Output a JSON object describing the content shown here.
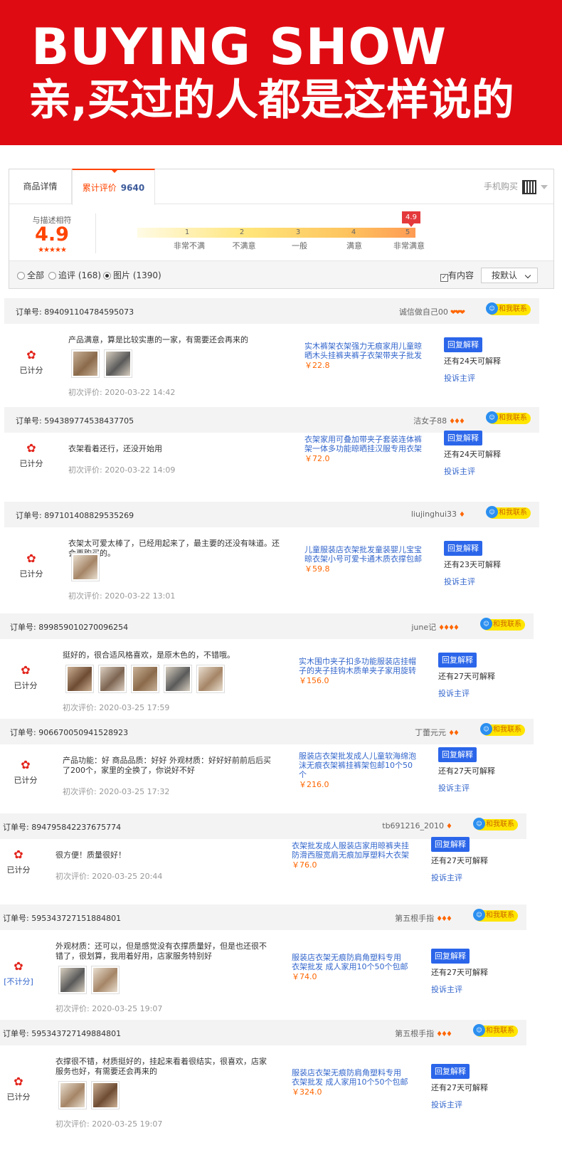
{
  "banner": {
    "title_en": "BUYING SHOW",
    "title_cn": "亲,买过的人都是这样说的"
  },
  "tabs": {
    "detail": "商品详情",
    "reviews": "累计评价",
    "reviews_count": "9640",
    "mobile_buy": "手机购买"
  },
  "rating": {
    "label": "与描述相符",
    "score": "4.9",
    "stars": "★★★★★",
    "flag": "4.9",
    "level": 4.9,
    "ticks": [
      "1",
      "2",
      "3",
      "4",
      "5"
    ],
    "tick_labels": [
      "非常不满",
      "不满意",
      "一般",
      "满意",
      "非常满意"
    ]
  },
  "filters": {
    "all": "全部",
    "followup": "追评 (168)",
    "pictures": "图片 (1390)",
    "has_content": "有内容",
    "sort": "按默认"
  },
  "common": {
    "order_label": "订单号: ",
    "contact": "和我联系",
    "reply": "回复解释",
    "complain": "投诉主评",
    "first_eval": "初次评价: "
  },
  "reviews": [
    {
      "order": "894091104784595073",
      "nick": "诚信做自己00",
      "badges": "❤❤❤",
      "rated": "已计分",
      "comment": "产品满意，算是比较实惠的一家，有需要还会再来的",
      "photos": 2,
      "date": "2020-03-22 14:42",
      "product": "实木裤架衣架强力无痕家用儿童晾晒木头挂裤夹裤子衣架带夹子批发",
      "price": "￥22.8",
      "remain": "还有24天可解释"
    },
    {
      "order": "594389774538437705",
      "nick": "洁女子88",
      "badges": "♦♦♦",
      "rated": "已计分",
      "comment": "衣架看着还行，还没开始用",
      "photos": 0,
      "date": "2020-03-22 14:09",
      "product": "衣架家用可叠加带夹子套装连体裤架一体多功能晾晒挂汉服专用衣架",
      "price": "￥72.0",
      "remain": "还有24天可解释"
    },
    {
      "order": "897101408829535269",
      "nick": "liujinghui33",
      "badges": "♦",
      "rated": "已计分",
      "comment": "衣架太可爱太棒了，已经用起来了，最主要的还没有味道。还会再购买的。",
      "photos": 1,
      "date": "2020-03-22 13:01",
      "product": "儿童服装店衣架批发童装婴儿宝宝晾衣架小号可爱卡通木质衣撑包邮",
      "price": "￥59.8",
      "remain": "还有23天可解释"
    },
    {
      "order": "899859010270096254",
      "nick": "june记",
      "badges": "♦♦♦♦",
      "rated": "已计分",
      "comment": "挺好的，很合适风格喜欢，是原木色的，不错哦。",
      "photos": 5,
      "date": "2020-03-25 17:59",
      "product": "实木围巾夹子扣多功能服装店挂帽子的夹子挂钩木质单夹子家用旋转",
      "price": "￥156.0",
      "remain": "还有27天可解释"
    },
    {
      "order": "906670050941528923",
      "nick": "丁蕾元元",
      "badges": "♦♦",
      "rated": "已计分",
      "comment": "产品功能：好 商品品质：好好 外观材质：好好好前前后后买了200个，家里的全换了，你说好不好",
      "photos": 0,
      "date": "2020-03-25 17:32",
      "product": "服装店衣架批发成人儿童软海绵泡沫无痕衣架裤挂裤架包邮10个50个",
      "price": "￥216.0",
      "remain": "还有27天可解释"
    },
    {
      "order": "894795842237675774",
      "nick": "tb691216_2010",
      "badges": "♦",
      "rated": "已计分",
      "comment": "很方便！质量很好！",
      "photos": 0,
      "date": "2020-03-25 20:44",
      "product": "衣架批发成人服装店家用晾裤夹挂防滑西服宽肩无痕加厚塑料大衣架",
      "price": "￥76.0",
      "remain": "还有27天可解释"
    },
    {
      "order": "595343727151884801",
      "nick": "第五根手指",
      "badges": "♦♦♦",
      "rated": "[不计分]",
      "comment": "外观材质：还可以，但是感觉没有衣撑质量好，但是也还很不错了，很划算，我用着好用，店家服务特别好",
      "photos": 2,
      "date": "2020-03-25 19:07",
      "product": "服装店衣架无痕防肩角塑料专用 衣架批发 成人家用10个50个包邮",
      "price": "￥74.0",
      "remain": "还有27天可解释"
    },
    {
      "order": "595343727149884801",
      "nick": "第五根手指",
      "badges": "♦♦♦",
      "rated": "已计分",
      "comment": "衣撑很不错，材质挺好的，挂起来看着很结实，很喜欢，店家服务也好，有需要还会再来的",
      "photos": 2,
      "date": "2020-03-25 19:07",
      "product": "服装店衣架无痕防肩角塑料专用 衣架批发 成人家用10个50个包邮",
      "price": "￥324.0",
      "remain": "还有27天可解释"
    }
  ]
}
